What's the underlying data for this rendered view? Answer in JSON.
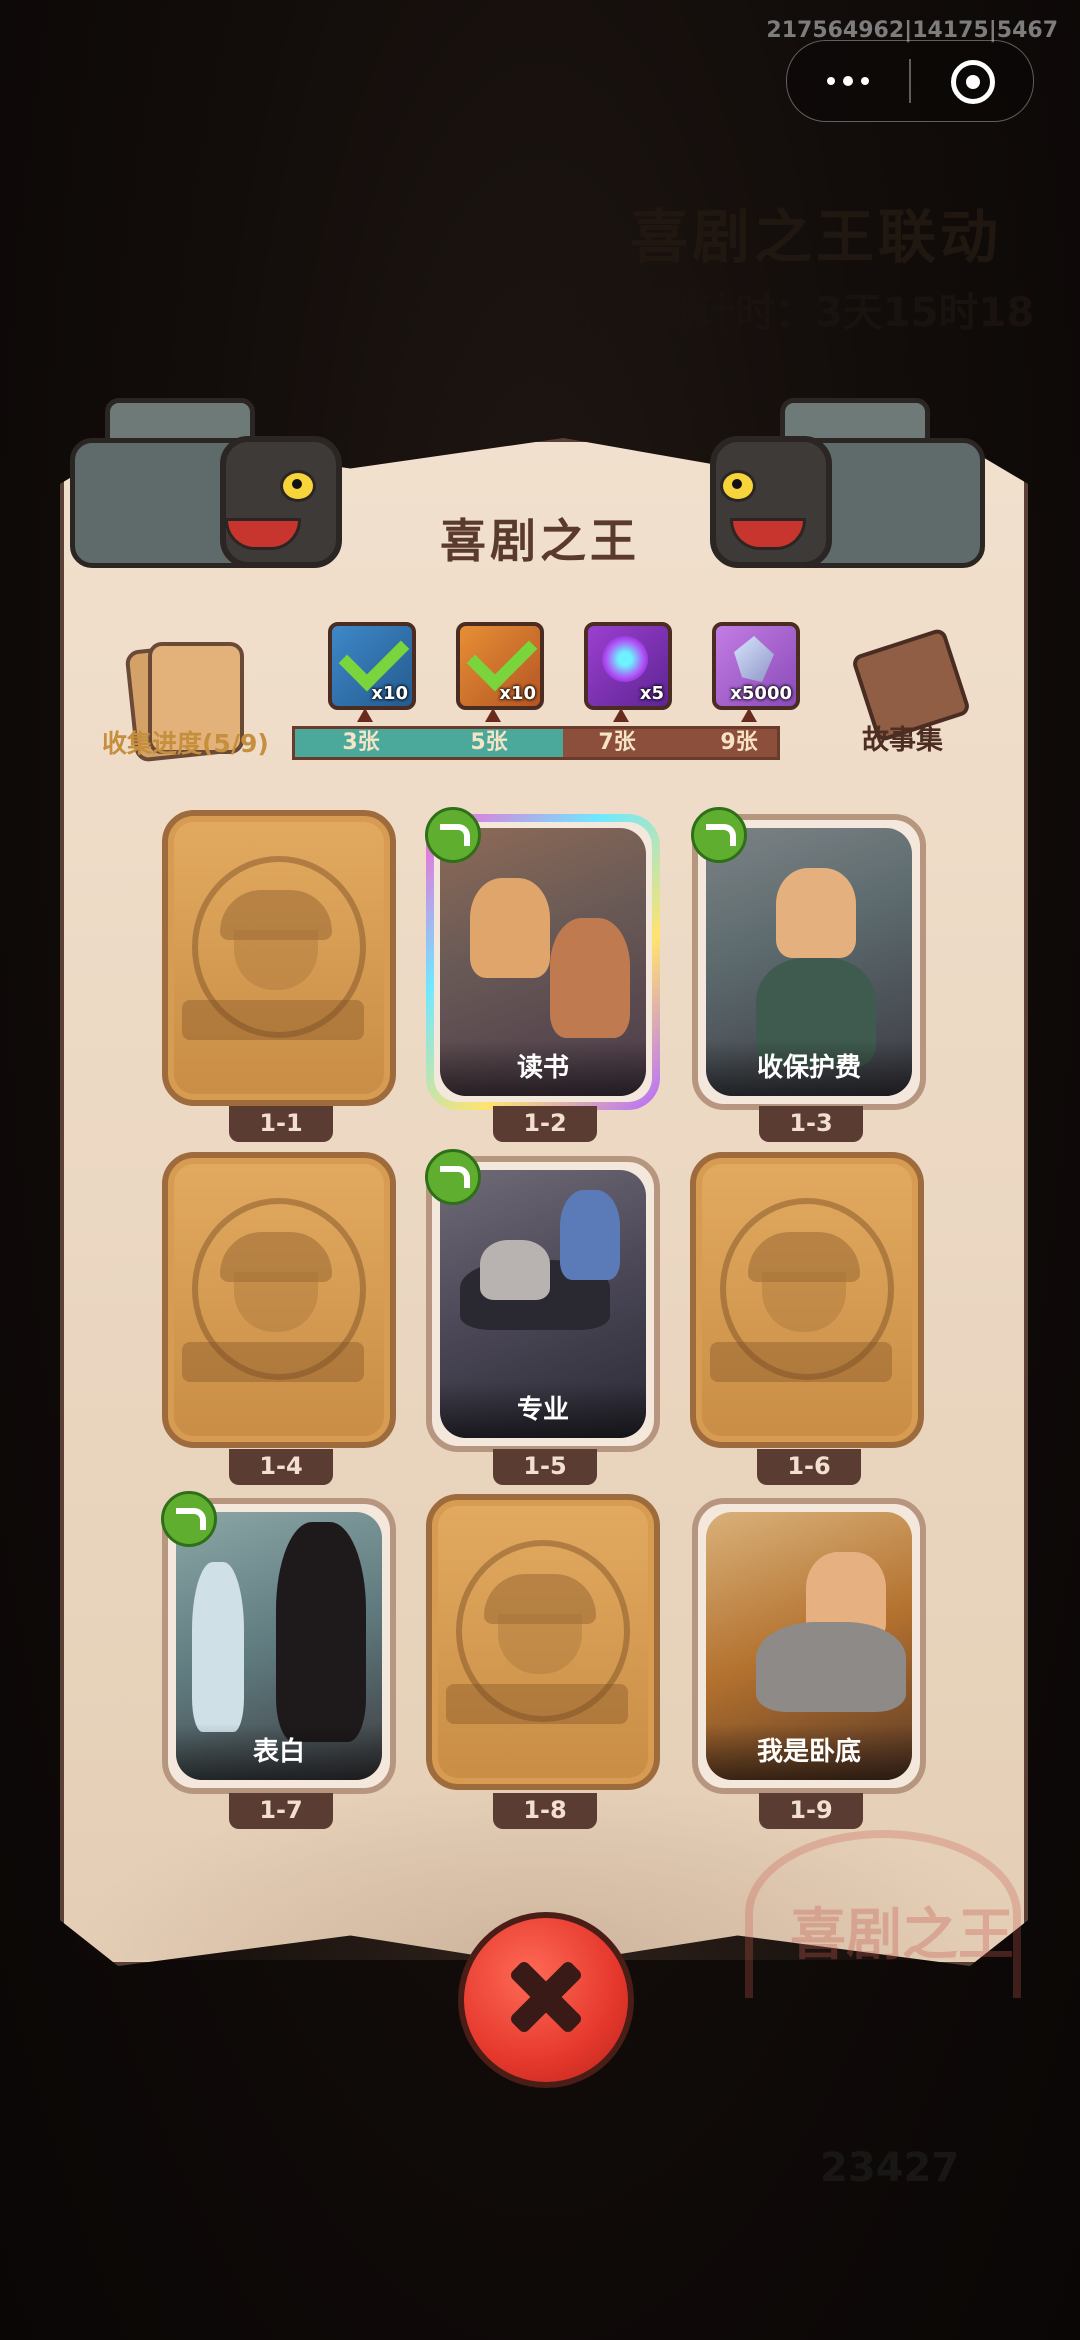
{
  "system": {
    "version": "217564962|14175|5467"
  },
  "background": {
    "title": "喜剧之王联动",
    "countdown": "活动倒计时：3天15时18",
    "score": "23427"
  },
  "panel": {
    "title": "喜剧之王",
    "progress_label": "收集进度(5/9)",
    "progress_value": 5,
    "progress_max": 9,
    "story_label": "故事集",
    "milestones": [
      {
        "label": "3张",
        "reward_icon": "ticket-icon",
        "amount": "x10",
        "claimed": true
      },
      {
        "label": "5张",
        "reward_icon": "chest-icon",
        "amount": "x10",
        "claimed": true
      },
      {
        "label": "7张",
        "reward_icon": "disc-gem-icon",
        "amount": "x5",
        "claimed": false
      },
      {
        "label": "9张",
        "reward_icon": "crystal-icon",
        "amount": "x5000",
        "claimed": false
      }
    ]
  },
  "cards": [
    {
      "id": "1-1",
      "title": "",
      "unlocked": false,
      "shiny": false
    },
    {
      "id": "1-2",
      "title": "读书",
      "unlocked": true,
      "shiny": true
    },
    {
      "id": "1-3",
      "title": "收保护费",
      "unlocked": true,
      "shiny": false
    },
    {
      "id": "1-4",
      "title": "",
      "unlocked": false,
      "shiny": false
    },
    {
      "id": "1-5",
      "title": "专业",
      "unlocked": true,
      "shiny": false
    },
    {
      "id": "1-6",
      "title": "",
      "unlocked": false,
      "shiny": false
    },
    {
      "id": "1-7",
      "title": "表白",
      "unlocked": true,
      "shiny": false
    },
    {
      "id": "1-8",
      "title": "",
      "unlocked": false,
      "shiny": false
    },
    {
      "id": "1-9",
      "title": "我是卧底",
      "unlocked": true,
      "shiny": false
    }
  ],
  "colors": {
    "accent_gold": "#c58f3d",
    "bar_teal": "#4aa99a",
    "close_red": "#e5382c",
    "share_green": "#5fae2f"
  }
}
